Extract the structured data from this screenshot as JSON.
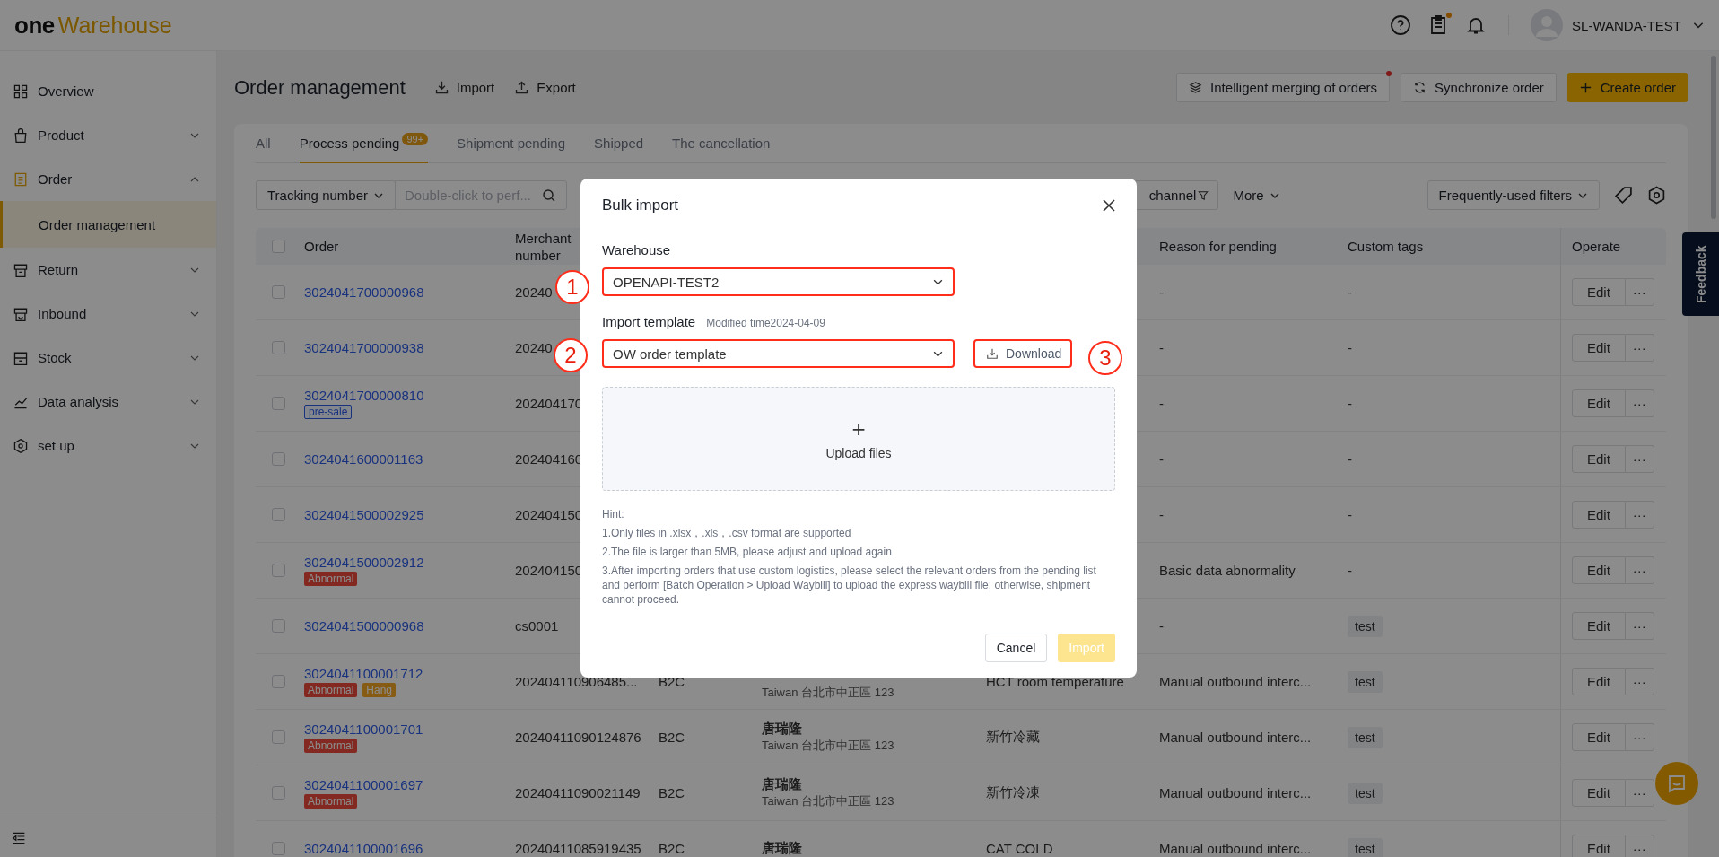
{
  "header": {
    "logo_part_1": "one",
    "logo_part_2": "Warehouse",
    "task_dot": true,
    "user": "SL-WANDA-TEST"
  },
  "sidebar": {
    "items": [
      {
        "label": "Overview",
        "selected": false
      },
      {
        "label": "Product",
        "selected": false,
        "expanded": false
      },
      {
        "label": "Order",
        "selected": true,
        "expanded": true,
        "children": [
          {
            "label": "Order management",
            "selected": true
          }
        ]
      },
      {
        "label": "Return",
        "selected": false,
        "expanded": false
      },
      {
        "label": "Inbound",
        "selected": false,
        "expanded": false
      },
      {
        "label": "Stock",
        "selected": false,
        "expanded": false
      },
      {
        "label": "Data analysis",
        "selected": false,
        "expanded": false
      },
      {
        "label": "set up",
        "selected": false,
        "expanded": false
      }
    ]
  },
  "page": {
    "title": "Order management",
    "import": "Import",
    "export": "Export",
    "merge_button": {
      "label": "Intelligent merging of orders",
      "dot": true
    },
    "sync_button": "Synchronize order",
    "create_button": "Create order"
  },
  "tabs": [
    {
      "label": "All",
      "selected": false
    },
    {
      "label": "Process pending",
      "selected": true,
      "badge": "99+"
    },
    {
      "label": "Shipment pending",
      "selected": false
    },
    {
      "label": "Shipped",
      "selected": false
    },
    {
      "label": "The cancellation",
      "selected": false
    }
  ],
  "filters": {
    "field_select": "Tracking number",
    "search": {
      "placeholder": "Double-click to perf..."
    },
    "channel": "channel",
    "more": "More",
    "frequent": "Frequently-used filters"
  },
  "table": {
    "header_checked": false,
    "columns": [
      {
        "kind": "order",
        "lines": [
          "Order"
        ]
      },
      {
        "kind": "merchant",
        "lines": [
          "Merchant",
          "number"
        ]
      },
      {
        "kind": "reason",
        "lines": [
          "Reason for pending"
        ]
      },
      {
        "kind": "tags",
        "lines": [
          "Custom tags"
        ]
      },
      {
        "kind": "operate",
        "lines": [
          "Operate"
        ]
      }
    ],
    "rows": [
      {
        "checked": false,
        "order": "3024041700000968",
        "tags": [],
        "merchant": "20240",
        "reason": "-",
        "custom_tag": {
          "kind": "none",
          "label": "-"
        },
        "edit": "Edit",
        "more": "···"
      },
      {
        "checked": false,
        "order": "3024041700000938",
        "tags": [],
        "merchant": "20240",
        "reason": "-",
        "custom_tag": {
          "kind": "none",
          "label": "-"
        },
        "edit": "Edit",
        "more": "···"
      },
      {
        "checked": false,
        "order": "3024041700000810",
        "tags": [
          {
            "kind": "presale",
            "label": "pre-sale"
          }
        ],
        "merchant": "202404170",
        "reason": "-",
        "custom_tag": {
          "kind": "none",
          "label": "-"
        },
        "edit": "Edit",
        "more": "···"
      },
      {
        "checked": false,
        "order": "3024041600001163",
        "tags": [],
        "merchant": "202404160",
        "reason": "-",
        "custom_tag": {
          "kind": "none",
          "label": "-"
        },
        "edit": "Edit",
        "more": "···"
      },
      {
        "checked": false,
        "order": "3024041500002925",
        "tags": [],
        "merchant": "202404150",
        "reason": "-",
        "custom_tag": {
          "kind": "none",
          "label": "-"
        },
        "edit": "Edit",
        "more": "···"
      },
      {
        "checked": false,
        "order": "3024041500002912",
        "tags": [
          {
            "kind": "abnormal",
            "label": "Abnormal"
          }
        ],
        "merchant": "202404150",
        "reason": "Basic data abnormality",
        "custom_tag": {
          "kind": "none",
          "label": "-"
        },
        "edit": "Edit",
        "more": "···"
      },
      {
        "checked": false,
        "order": "3024041500000968",
        "tags": [],
        "merchant": "cs0001",
        "reason": "-",
        "custom_tag": {
          "kind": "chip",
          "label": "test"
        },
        "edit": "Edit",
        "more": "···"
      },
      {
        "checked": false,
        "order": "3024041100001712",
        "tags": [
          {
            "kind": "abnormal",
            "label": "Abnormal"
          },
          {
            "kind": "hang",
            "label": "Hang"
          }
        ],
        "merchant": "202404110906485...",
        "type": "B2C",
        "address": "Taiwan 台北市中正區 123",
        "logistics": "HCT room temperature",
        "reason": "Manual outbound interc...",
        "custom_tag": {
          "kind": "chip",
          "label": "test"
        },
        "edit": "Edit",
        "more": "···"
      },
      {
        "checked": false,
        "order": "3024041100001701",
        "tags": [
          {
            "kind": "abnormal",
            "label": "Abnormal"
          }
        ],
        "merchant": "20240411090124876",
        "type": "B2C",
        "consignee": "唐瑞隆",
        "address": "Taiwan 台北市中正區 123",
        "logistics": "新竹冷藏",
        "reason": "Manual outbound interc...",
        "custom_tag": {
          "kind": "chip",
          "label": "test"
        },
        "edit": "Edit",
        "more": "···"
      },
      {
        "checked": false,
        "order": "3024041100001697",
        "tags": [
          {
            "kind": "abnormal",
            "label": "Abnormal"
          }
        ],
        "merchant": "20240411090021149",
        "type": "B2C",
        "consignee": "唐瑞隆",
        "address": "Taiwan 台北市中正區 123",
        "logistics": "新竹冷凍",
        "reason": "Manual outbound interc...",
        "custom_tag": {
          "kind": "chip",
          "label": "test"
        },
        "edit": "Edit",
        "more": "···"
      },
      {
        "checked": false,
        "order": "3024041100001696",
        "tags": [],
        "merchant": "20240411085919435",
        "type": "B2C",
        "consignee": "唐瑞隆",
        "logistics": "CAT COLD",
        "reason": "Manual outbound interc...",
        "custom_tag": {
          "kind": "chip",
          "label": "test"
        },
        "edit": "Edit",
        "more": "···"
      }
    ]
  },
  "feedback": "Feedback",
  "dialog": {
    "title": "Bulk import",
    "warehouse": {
      "label": "Warehouse",
      "value": "OPENAPI-TEST2",
      "highlighted": true,
      "marker": "1"
    },
    "template": {
      "label": "Import template",
      "modified": "Modified time2024-04-09",
      "value": "OW order template",
      "highlighted": true,
      "marker": "2"
    },
    "download": {
      "label": "Download",
      "highlighted": true,
      "marker": "3"
    },
    "upload": {
      "symbol": "+",
      "label": "Upload files"
    },
    "hint_title": "Hint:",
    "hints": [
      "1.Only files in .xlsx，.xls，.csv format are supported",
      "2.The file is larger than 5MB, please adjust and upload again",
      "3.After importing orders that use custom logistics, please select the relevant orders from the pending list and perform [Batch Operation > Upload Waybill] to upload the express waybill file; otherwise, shipment cannot proceed."
    ],
    "cancel": "Cancel",
    "import": {
      "label": "Import",
      "disabled": true
    }
  }
}
